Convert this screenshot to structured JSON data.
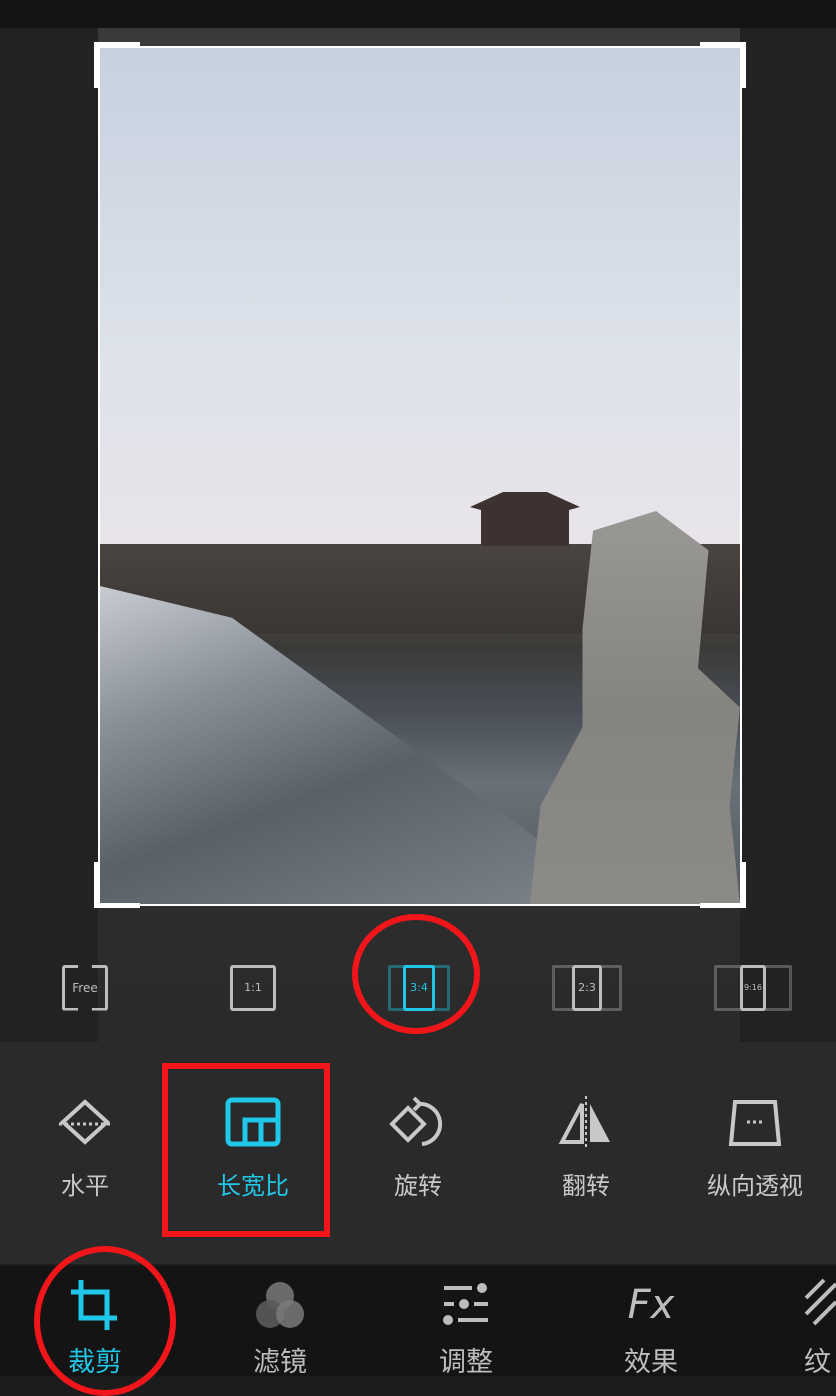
{
  "accent_color": "#1fc7e8",
  "highlight_color": "#f2161b",
  "aspect_ratios": [
    {
      "label": "Free",
      "icon": "free-crop-icon",
      "active": false
    },
    {
      "label": "1:1",
      "icon": "ratio-1-1-icon",
      "active": false
    },
    {
      "label": "3:4",
      "icon": "ratio-3-4-icon",
      "active": true
    },
    {
      "label": "2:3",
      "icon": "ratio-2-3-icon",
      "active": false
    },
    {
      "label": "9:16",
      "icon": "ratio-9-16-icon",
      "active": false
    }
  ],
  "crop_tools": [
    {
      "label": "水平",
      "icon": "straighten-icon"
    },
    {
      "label": "长宽比",
      "icon": "aspect-ratio-icon",
      "active": true
    },
    {
      "label": "旋转",
      "icon": "rotate-icon"
    },
    {
      "label": "翻转",
      "icon": "flip-icon"
    },
    {
      "label": "纵向透视",
      "icon": "vertical-perspective-icon"
    }
  ],
  "bottom_nav": [
    {
      "label": "裁剪",
      "icon": "crop-icon",
      "active": true
    },
    {
      "label": "滤镜",
      "icon": "filter-icon"
    },
    {
      "label": "调整",
      "icon": "adjust-icon"
    },
    {
      "label": "效果",
      "icon": "fx-icon"
    },
    {
      "label": "纹",
      "icon": "texture-icon"
    }
  ]
}
